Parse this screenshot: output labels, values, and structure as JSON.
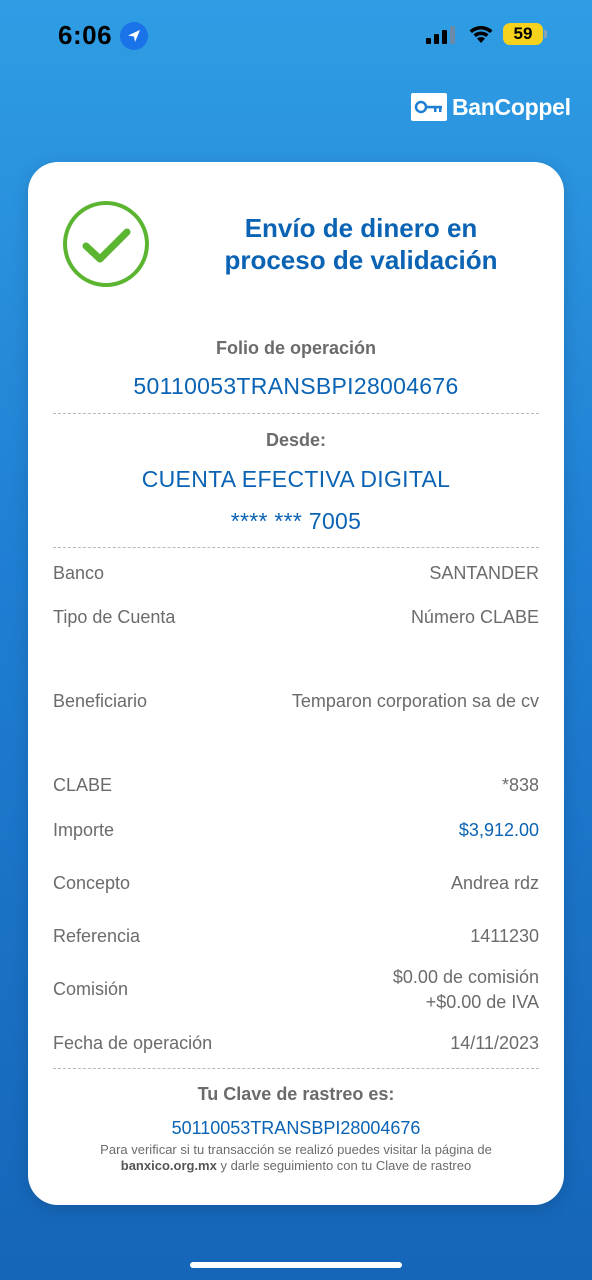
{
  "status_bar": {
    "time": "6:06",
    "battery": "59",
    "icons": [
      "location-arrow-icon",
      "cellular-signal-icon",
      "wifi-icon",
      "battery-icon"
    ]
  },
  "brand": {
    "name": "BanCoppel",
    "icon": "key-icon"
  },
  "receipt": {
    "status_icon": "check-circle-icon",
    "title_line1": "Envío de dinero en",
    "title_line2": "proceso de validación",
    "folio_label": "Folio de operación",
    "folio_value": "50110053TRANSBPI28004676",
    "from_label": "Desde:",
    "from_account_name": "CUENTA EFECTIVA DIGITAL",
    "from_account_number": "**** *** 7005",
    "rows": [
      {
        "label": "Banco",
        "value": "SANTANDER"
      },
      {
        "label": "Tipo de Cuenta",
        "value": "Número CLABE"
      },
      {
        "label": "Beneficiario",
        "value": "Temparon corporation sa de cv"
      },
      {
        "label": "CLABE",
        "value": "*838"
      },
      {
        "label": "Importe",
        "value": "$3,912.00"
      },
      {
        "label": "Concepto",
        "value": "Andrea rdz"
      },
      {
        "label": "Referencia",
        "value": "1411230"
      },
      {
        "label": "Comisión",
        "value": "$0.00 de comisión",
        "value2": "+$0.00 de IVA"
      },
      {
        "label": "Fecha de operación",
        "value": "14/11/2023"
      }
    ],
    "tracking_label": "Tu Clave de rastreo es:",
    "tracking_value": "50110053TRANSBPI28004676",
    "note_part1": "Para verificar si tu transacción se realizó puedes visitar la página de",
    "note_link": "banxico.org.mx",
    "note_part2": "y darle seguimiento con tu Clave de rastreo"
  },
  "colors": {
    "accent_blue": "#0b63b4",
    "success_green": "#5cb531",
    "background_top": "#2f9de4",
    "background_bottom": "#1565b8"
  }
}
